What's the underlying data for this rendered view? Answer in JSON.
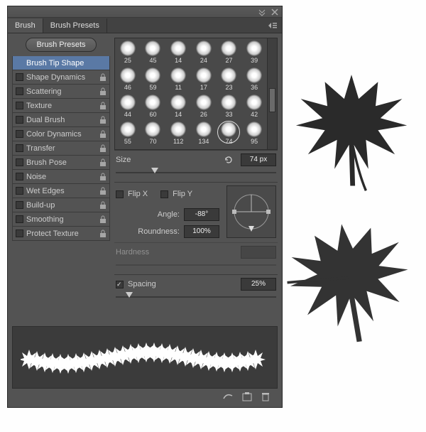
{
  "tabs": {
    "brush": "Brush",
    "presets": "Brush Presets"
  },
  "buttons": {
    "presets": "Brush Presets"
  },
  "options": {
    "tip": "Brush Tip Shape",
    "shapedyn": "Shape Dynamics",
    "scatter": "Scattering",
    "texture": "Texture",
    "dual": "Dual Brush",
    "colordyn": "Color Dynamics",
    "transfer": "Transfer",
    "pose": "Brush Pose",
    "noise": "Noise",
    "wetedges": "Wet Edges",
    "buildup": "Build-up",
    "smoothing": "Smoothing",
    "protect": "Protect Texture"
  },
  "thumbs": [
    {
      "n": "25"
    },
    {
      "n": "45"
    },
    {
      "n": "14"
    },
    {
      "n": "24"
    },
    {
      "n": "27"
    },
    {
      "n": "39"
    },
    {
      "n": "46"
    },
    {
      "n": "59"
    },
    {
      "n": "11"
    },
    {
      "n": "17"
    },
    {
      "n": "23"
    },
    {
      "n": "36"
    },
    {
      "n": "44"
    },
    {
      "n": "60"
    },
    {
      "n": "14"
    },
    {
      "n": "26"
    },
    {
      "n": "33"
    },
    {
      "n": "42"
    },
    {
      "n": "55"
    },
    {
      "n": "70"
    },
    {
      "n": "112"
    },
    {
      "n": "134"
    },
    {
      "n": "74",
      "sel": true
    },
    {
      "n": "95"
    }
  ],
  "size": {
    "label": "Size",
    "value": "74 px"
  },
  "flip": {
    "x": "Flip X",
    "y": "Flip Y"
  },
  "angle": {
    "label": "Angle:",
    "value": "-88°"
  },
  "roundness": {
    "label": "Roundness:",
    "value": "100%"
  },
  "hardness": {
    "label": "Hardness"
  },
  "spacing": {
    "label": "Spacing",
    "value": "25%"
  }
}
